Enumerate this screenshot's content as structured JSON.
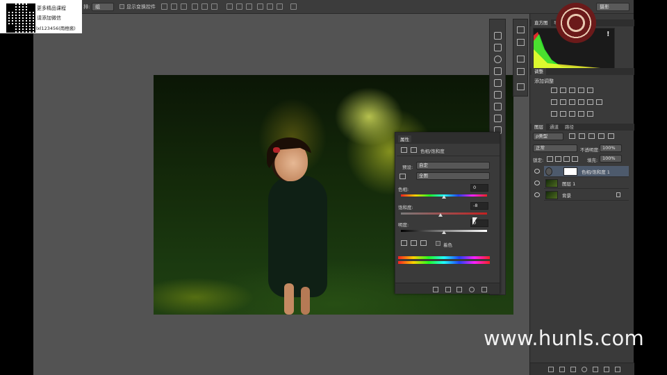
{
  "options_bar": {
    "mode_label": "排:",
    "mode_value": "组",
    "show_transform_label": "显示变换控件",
    "workspace": "摄影"
  },
  "overlay": {
    "qr_lines": [
      "更多精品课程",
      "请添加微信",
      "lxl123456(雨橙酱)"
    ],
    "watermark": "www.hunls.com"
  },
  "histogram_panel": {
    "tabs": [
      "直方图",
      "导"
    ],
    "warning": "!"
  },
  "adjustments_panel": {
    "tab": "调整",
    "title": "添加调整"
  },
  "layers_panel": {
    "tabs": [
      "图层",
      "通道",
      "路径"
    ],
    "filter_kind": "ρ类型",
    "blend_mode": "正常",
    "opacity_label": "不透明度:",
    "opacity_value": "100%",
    "lock_label": "锁定:",
    "fill_label": "填充:",
    "fill_value": "100%",
    "layers": [
      {
        "name": "色相/饱和度 1",
        "selected": true
      },
      {
        "name": "图层 1",
        "selected": false
      },
      {
        "name": "背景",
        "selected": false
      }
    ]
  },
  "properties_panel": {
    "tab": "属性",
    "title": "色相/饱和度",
    "preset_label": "预设:",
    "preset_value": "自定",
    "channel_value": "全图",
    "hue_label": "色相:",
    "hue_value": "0",
    "saturation_label": "饱和度:",
    "saturation_value": "-8",
    "lightness_label": "明度:",
    "lightness_value": "0",
    "colorize_label": "着色",
    "colorize_checked": false
  },
  "colors": {
    "panel_bg": "#3a3a3a",
    "canvas_bg": "#535353",
    "selected_layer": "#4d5a6c"
  }
}
